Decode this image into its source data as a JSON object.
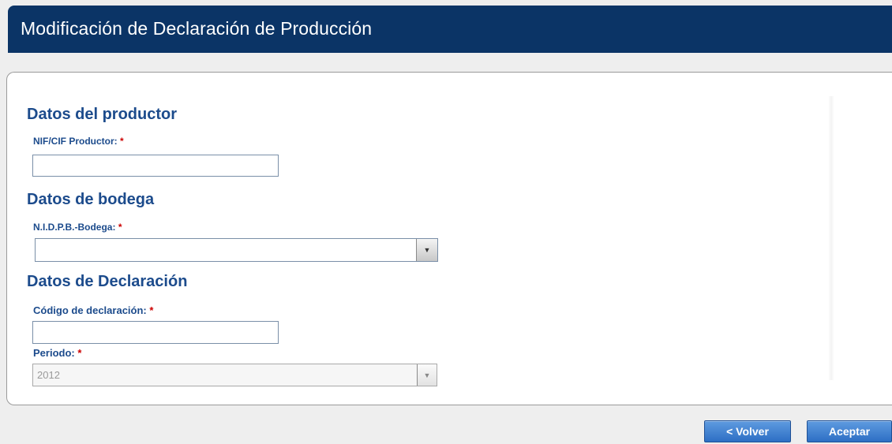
{
  "header": {
    "title": "Modificación de Declaración de Producción"
  },
  "productor": {
    "section_title": "Datos del productor",
    "nif_label": "NIF/CIF Productor:",
    "nif_value": ""
  },
  "bodega": {
    "section_title": "Datos de bodega",
    "nidpb_label": "N.I.D.P.B.-Bodega:",
    "nidpb_value": ""
  },
  "declaracion": {
    "section_title": "Datos de Declaración",
    "codigo_label": "Código de declaración:",
    "codigo_value": "",
    "periodo_label": "Periodo:",
    "periodo_value": "2012"
  },
  "required_marker": "*",
  "buttons": {
    "back": "< Volver",
    "accept": "Aceptar"
  },
  "colors": {
    "header_bg": "#0b3466",
    "accent": "#1c4b8c",
    "required": "#cc0000"
  }
}
